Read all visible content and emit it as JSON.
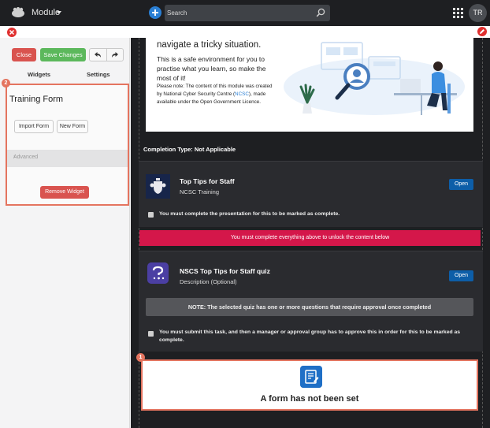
{
  "topbar": {
    "module_label": "Module",
    "search_placeholder": "Search",
    "avatar_initials": "TR"
  },
  "editor": {
    "close_label": "Close",
    "save_label": "Save Changes",
    "tabs": [
      "Widgets",
      "Settings"
    ]
  },
  "widget_panel": {
    "badge": "2",
    "title": "Training Form",
    "import_label": "Import Form",
    "new_label": "New Form",
    "advanced_label": "Advanced",
    "remove_label": "Remove Widget"
  },
  "intro": {
    "heading": "navigate a tricky situation.",
    "body": "This is a safe environment for you to practise what you learn, so make the most of it!",
    "note_before": "Please note: The content of this module was created by National Cyber Security Centre (",
    "note_link": "NCSC",
    "note_after": "), made available under the Open Government Licence."
  },
  "completion_type": "Completion Type: Not Applicable",
  "task1": {
    "title": "Top Tips for Staff",
    "subtitle": "NCSC Training",
    "open_label": "Open",
    "check_text": "You must complete the presentation for this to be marked as complete."
  },
  "unlock_banner": "You must complete everything above to unlock the content below",
  "task2": {
    "title": "NSCS Top Tips for Staff quiz",
    "subtitle": "Description (Optional)",
    "open_label": "Open",
    "note": "NOTE: The selected quiz has one or more questions that require approval once completed",
    "check_text": "You must submit this task, and then a manager or approval group has to approve this in order for this to be marked as complete."
  },
  "form_widget": {
    "badge": "1",
    "empty_text": "A form has not been set"
  },
  "colors": {
    "accent_blue": "#0d5ea8",
    "danger_red": "#d9534f",
    "success_green": "#5cb85c",
    "highlight_orange": "#e4745f",
    "banner_crimson": "#d4174a"
  }
}
